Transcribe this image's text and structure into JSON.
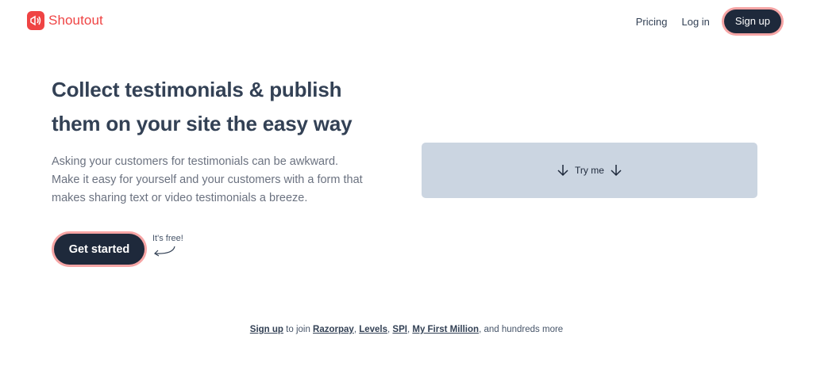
{
  "brand": {
    "name": "Shoutout",
    "color": "#ef4444"
  },
  "nav": {
    "pricing": "Pricing",
    "login": "Log in",
    "signup": "Sign up"
  },
  "hero": {
    "title_line1": "Collect testimonials & publish",
    "title_line2": "them on your site the easy way",
    "description_line1": "Asking your customers for testimonials can be awkward.",
    "description_line2": "Make it easy for yourself and your customers with a form that",
    "description_line3": "makes sharing text or video testimonials a breeze."
  },
  "cta": {
    "button": "Get started",
    "note": "It's free!"
  },
  "try_panel": {
    "label": "Try me",
    "icon": "arrow-down-icon"
  },
  "footer": {
    "signup_link": "Sign up",
    "text_join": " to join ",
    "companies": [
      "Razorpay",
      "Levels",
      "SPI",
      "My First Million"
    ],
    "sep1": ", ",
    "sep2": ", ",
    "sep3": ", ",
    "tail": ", and hundreds more"
  },
  "colors": {
    "dark": "#1e293b",
    "accent_ring": "#f6a5a5",
    "panel": "#cbd5e1"
  }
}
